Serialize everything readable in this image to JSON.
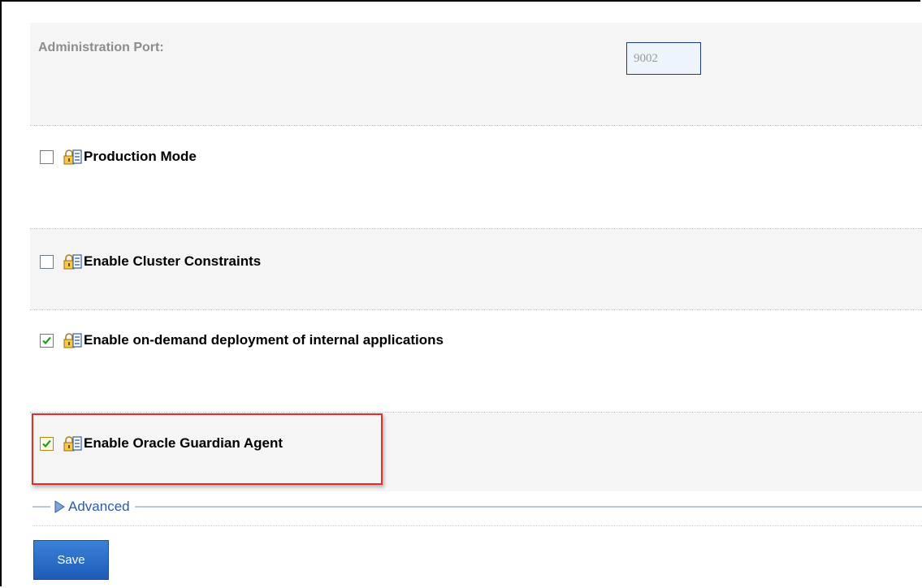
{
  "admin_port": {
    "label": "Administration Port:",
    "value": "9002"
  },
  "options": [
    {
      "label": "Production Mode",
      "checked": false
    },
    {
      "label": "Enable Cluster Constraints",
      "checked": false
    },
    {
      "label": "Enable on-demand deployment of internal applications",
      "checked": true
    },
    {
      "label": "Enable Oracle Guardian Agent",
      "checked": true,
      "highlighted": true
    }
  ],
  "advanced": {
    "label": "Advanced"
  },
  "save_button": {
    "label": "Save"
  },
  "colors": {
    "highlight_border": "#e32b2b",
    "save_button": "#2a6ecb",
    "link": "#2c5aa7",
    "row_shade": "#f5f5f5"
  },
  "icons": {
    "option_icon": "lock-edit-icon",
    "advanced_icon": "triangle-right-icon"
  }
}
